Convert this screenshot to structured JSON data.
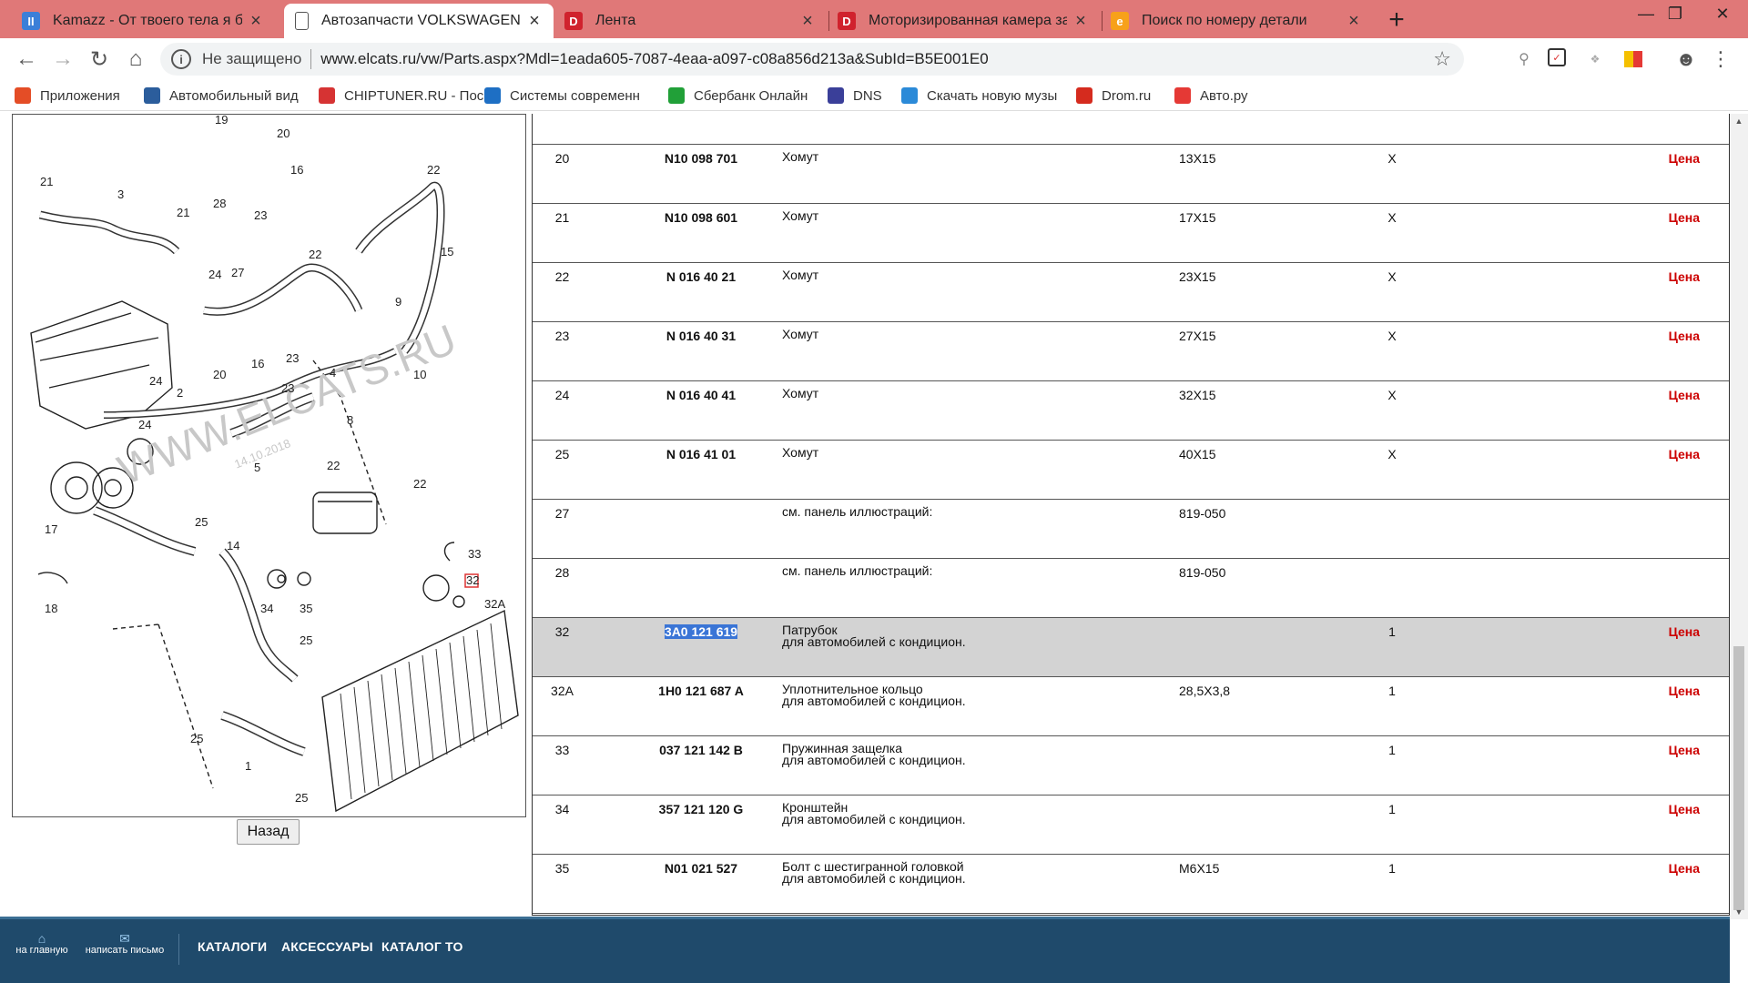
{
  "browser": {
    "tabs": [
      {
        "title": "Kamazz - От твоего тела я без ума",
        "favicon": "kamazz-icon",
        "color": "#3b7fd8",
        "glyph": "II",
        "active": false
      },
      {
        "title": "Автозапчасти VOLKSWAGEN - зап",
        "favicon": "document-icon",
        "color": "#ffffff",
        "glyph": "",
        "active": true
      },
      {
        "title": "Лента",
        "favicon": "lenta-icon",
        "color": "#d0222d",
        "glyph": "D",
        "active": false
      },
      {
        "title": "Моторизированная камера задн",
        "favicon": "lenta-icon",
        "color": "#d0222d",
        "glyph": "D",
        "active": false
      },
      {
        "title": "Поиск по номеру детали",
        "favicon": "e-icon",
        "color": "#f7a11a",
        "glyph": "e",
        "active": false
      }
    ],
    "security_label": "Не защищено",
    "url": "www.elcats.ru/vw/Parts.aspx?Mdl=1eada605-7087-4eaa-a097-c08a856d213a&SubId=B5E001E0",
    "bookmarks": [
      {
        "label": "Приложения",
        "icon": "apps-grid-icon",
        "color": "#e44d26"
      },
      {
        "label": "Автомобильный вид",
        "icon": "auto-ssm-icon",
        "color": "#2b5d9c"
      },
      {
        "label": "CHIPTUNER.RU - Пос",
        "icon": "chiptuner-icon",
        "color": "#d63333"
      },
      {
        "label": "Системы современн",
        "icon": "ca-icon",
        "color": "#1e6fc4"
      },
      {
        "label": "Сбербанк Онлайн",
        "icon": "sberbank-icon",
        "color": "#21a038"
      },
      {
        "label": "DNS",
        "icon": "dns-icon",
        "color": "#3a3f99"
      },
      {
        "label": "Скачать новую музы",
        "icon": "music-icon",
        "color": "#2b8ad8"
      },
      {
        "label": "Drom.ru",
        "icon": "drom-icon",
        "color": "#d52b1e"
      },
      {
        "label": "Авто.ру",
        "icon": "autoru-icon",
        "color": "#e53935"
      }
    ]
  },
  "diagram": {
    "watermark": "WWW.ELCATS.RU",
    "date": "14.10.2018",
    "back_label": "Назад",
    "callouts": [
      "19",
      "20",
      "16",
      "22",
      "21",
      "3",
      "21",
      "28",
      "23",
      "15",
      "24",
      "27",
      "22",
      "9",
      "20",
      "16",
      "23",
      "10",
      "24",
      "2",
      "4",
      "23",
      "8",
      "24",
      "5",
      "22",
      "22",
      "17",
      "25",
      "14",
      "33",
      "32",
      "32A",
      "18",
      "34",
      "35",
      "25",
      "25",
      "1",
      "25"
    ]
  },
  "parts": {
    "price_label": "Цена",
    "rows": [
      {
        "pos": "20",
        "number": "N10 098 701",
        "desc": [
          "Хомут"
        ],
        "dim": "13X15",
        "qty": "X",
        "price": true,
        "selected": false
      },
      {
        "pos": "21",
        "number": "N10 098 601",
        "desc": [
          "Хомут"
        ],
        "dim": "17X15",
        "qty": "X",
        "price": true,
        "selected": false
      },
      {
        "pos": "22",
        "number": "N 016 40 21",
        "desc": [
          "Хомут"
        ],
        "dim": "23X15",
        "qty": "X",
        "price": true,
        "selected": false
      },
      {
        "pos": "23",
        "number": "N 016 40 31",
        "desc": [
          "Хомут"
        ],
        "dim": "27X15",
        "qty": "X",
        "price": true,
        "selected": false
      },
      {
        "pos": "24",
        "number": "N 016 40 41",
        "desc": [
          "Хомут"
        ],
        "dim": "32X15",
        "qty": "X",
        "price": true,
        "selected": false
      },
      {
        "pos": "25",
        "number": "N 016 41 01",
        "desc": [
          "Хомут"
        ],
        "dim": "40X15",
        "qty": "X",
        "price": true,
        "selected": false
      },
      {
        "pos": "27",
        "number": "",
        "desc": [
          "см. панель иллюстраций:"
        ],
        "dim": "819-050",
        "qty": "",
        "price": false,
        "selected": false
      },
      {
        "pos": "28",
        "number": "",
        "desc": [
          "см. панель иллюстраций:"
        ],
        "dim": "819-050",
        "qty": "",
        "price": false,
        "selected": false
      },
      {
        "pos": "32",
        "number": "3A0 121 619",
        "desc": [
          "Патрубок",
          "для автомобилей с кондицион."
        ],
        "dim": "",
        "qty": "1",
        "price": true,
        "selected": true
      },
      {
        "pos": "32A",
        "number": "1H0 121 687 A",
        "desc": [
          "Уплотнительное кольцо",
          "для автомобилей с кондицион."
        ],
        "dim": "28,5X3,8",
        "qty": "1",
        "price": true,
        "selected": false
      },
      {
        "pos": "33",
        "number": "037 121 142 B",
        "desc": [
          "Пружинная защелка",
          "для автомобилей с кондицион."
        ],
        "dim": "",
        "qty": "1",
        "price": true,
        "selected": false
      },
      {
        "pos": "34",
        "number": "357 121 120 G",
        "desc": [
          "Кронштейн",
          "для автомобилей с кондицион."
        ],
        "dim": "",
        "qty": "1",
        "price": true,
        "selected": false
      },
      {
        "pos": "35",
        "number": "N01 021 527",
        "desc": [
          "Болт с шестигранной головкой",
          "для автомобилей с кондицион."
        ],
        "dim": "M6X15",
        "qty": "1",
        "price": true,
        "selected": false
      }
    ]
  },
  "footer": {
    "home_label": "на главную",
    "mail_label": "написать письмо",
    "links": [
      "КАТАЛОГИ",
      "АКСЕССУАРЫ",
      "КАТАЛОГ ТО"
    ]
  }
}
